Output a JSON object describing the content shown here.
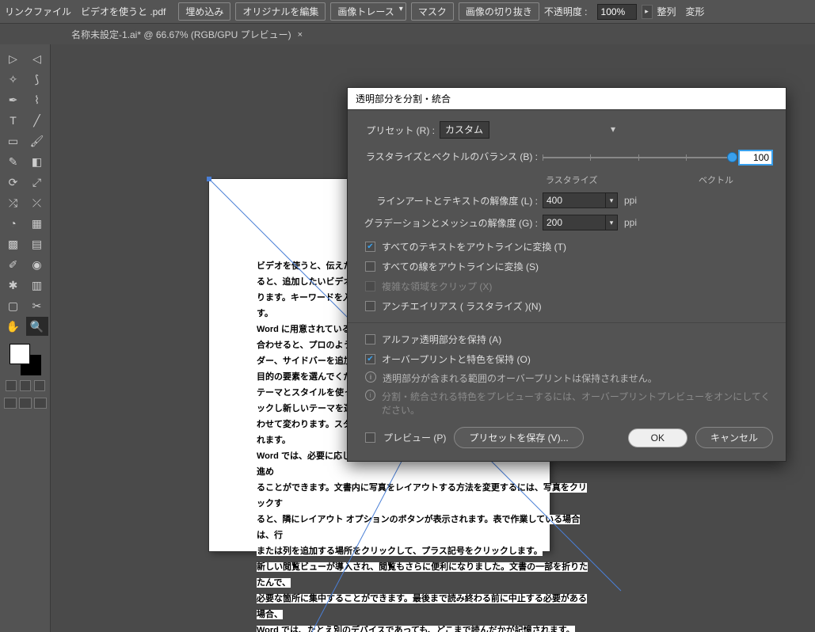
{
  "controlbar": {
    "label": "リンクファイル",
    "filename": "ビデオを使うと .pdf",
    "embed": "埋め込み",
    "edit_original": "オリジナルを編集",
    "image_trace": "画像トレース",
    "mask": "マスク",
    "crop": "画像の切り抜き",
    "opacity_label": "不透明度 :",
    "opacity_value": "100%",
    "arrange": "整列",
    "transform": "変形"
  },
  "tab": {
    "name": "名称未設定-1.ai* @ 66.67% (RGB/GPU プレビュー)",
    "close": "×"
  },
  "document_text": "ビデオを使うと、伝えたい\nると、追加したいビデオを\nります。キーワードを入力\nす。\nWord に用意されている\n合わせると、プロのよう\nダー、サイドバーを追加\n目的の要素を選んでくだ\nテーマとスタイルを使っ\nックし新しいテーマを選\nわせて変わります。スタ\nれます。\nWord では、必要に応じてその場に新しいボタンが表示されるため、効率よく操作を進め\nることができます。文書内に写真をレイアウトする方法を変更するには、写真をクリックす\nると、隣にレイアウト オプションのボタンが表示されます。表で作業している場合は、行\nまたは列を追加する場所をクリックして、プラス記号をクリックします。\n新しい閲覧ビューが導入され、閲覧もさらに便利になりました。文書の一部を折りたたんで、\n必要な箇所に集中することができます。最後まで読み終わる前に中止する必要がある場合、\nWord では、たとえ別のデバイスであっても、どこまで読んだかが記憶されます。",
  "dialog": {
    "title": "透明部分を分割・統合",
    "preset_label": "プリセット (R) :",
    "preset_value": "カスタム",
    "balance_label": "ラスタライズとベクトルのバランス (B) :",
    "balance_value": "100",
    "balance_left": "ラスタライズ",
    "balance_right": "ベクトル",
    "lineart_label": "ラインアートとテキストの解像度 (L) :",
    "lineart_value": "400",
    "gradient_label": "グラデーションとメッシュの解像度 (G) :",
    "gradient_value": "200",
    "ppi": "ppi",
    "chk_text_outline": "すべてのテキストをアウトラインに変換 (T)",
    "chk_stroke_outline": "すべての線をアウトラインに変換 (S)",
    "chk_clip": "複雑な領域をクリップ (X)",
    "chk_antialias": "アンチエイリアス ( ラスタライズ )(N)",
    "chk_alpha": "アルファ透明部分を保持 (A)",
    "chk_overprint": "オーバープリントと特色を保持 (O)",
    "info1": "透明部分が含まれる範囲のオーバープリントは保持されません。",
    "info2": "分割・統合される特色をプレビューするには、オーバープリントプレビューをオンにしてください。",
    "chk_preview": "プレビュー (P)",
    "btn_save_preset": "プリセットを保存 (V)...",
    "btn_ok": "OK",
    "btn_cancel": "キャンセル"
  }
}
